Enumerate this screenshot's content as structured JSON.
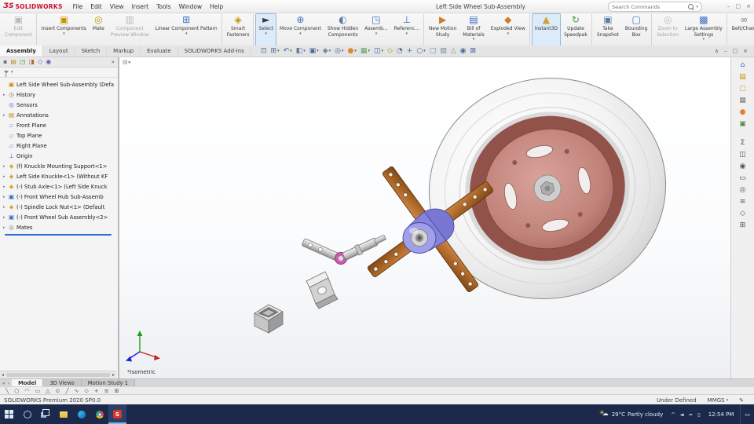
{
  "window": {
    "logo_mark": "ƷS",
    "logo_text": "SOLIDWORKS",
    "menus": [
      {
        "name": "menu-file",
        "label": "File"
      },
      {
        "name": "menu-edit",
        "label": "Edit"
      },
      {
        "name": "menu-view",
        "label": "View"
      },
      {
        "name": "menu-insert",
        "label": "Insert"
      },
      {
        "name": "menu-tools",
        "label": "Tools"
      },
      {
        "name": "menu-window",
        "label": "Window"
      },
      {
        "name": "menu-help",
        "label": "Help"
      }
    ],
    "title": "Left Side Wheel Sub-Assembly",
    "search_placeholder": "Search Commands",
    "search_dd": "▾",
    "controls": [
      {
        "name": "minimize-window-button",
        "ch": "–"
      },
      {
        "name": "maximize-window-button",
        "ch": "▢"
      },
      {
        "name": "close-window-button",
        "ch": "×"
      }
    ]
  },
  "ribbon": {
    "buttons": [
      {
        "name": "edit-component-button",
        "iname": "edit-component-icon",
        "l1": "Edit",
        "l2": "Component",
        "ch": "▣",
        "c": "#9aa6b4",
        "cls": "disabled",
        "sep": "sep",
        "dd": ""
      },
      {
        "name": "insert-components-button",
        "iname": "insert-components-icon",
        "l1": "Insert Components",
        "l2": "",
        "ch": "▣",
        "c": "#c79100",
        "cls": "",
        "sep": "",
        "dd": "▾"
      },
      {
        "name": "mate-button",
        "iname": "mate-icon",
        "l1": "Mate",
        "l2": "",
        "ch": "◎",
        "c": "#c79100",
        "cls": "",
        "sep": "",
        "dd": ""
      },
      {
        "name": "component-preview-window-button",
        "iname": "component-preview-window-icon",
        "l1": "Component",
        "l2": "Preview Window",
        "ch": "▥",
        "c": "#9aa6b4",
        "cls": "disabled",
        "sep": "",
        "dd": ""
      },
      {
        "name": "linear-component-pattern-button",
        "iname": "linear-component-pattern-icon",
        "l1": "Linear Component Pattern",
        "l2": "",
        "ch": "⊞",
        "c": "#3b6fc4",
        "cls": "",
        "sep": "sep",
        "dd": "▾"
      },
      {
        "name": "smart-fasteners-button",
        "iname": "smart-fasteners-icon",
        "l1": "Smart",
        "l2": "Fasteners",
        "ch": "◈",
        "c": "#c79100",
        "cls": "",
        "sep": "sep",
        "dd": ""
      },
      {
        "name": "select-button",
        "iname": "select-cursor-icon",
        "l1": "Select",
        "l2": "",
        "ch": "►",
        "c": "#3a3a3a",
        "cls": "active",
        "sep": "",
        "dd": "▾"
      },
      {
        "name": "move-component-button",
        "iname": "move-component-icon",
        "l1": "Move Component",
        "l2": "",
        "ch": "⊕",
        "c": "#3b6fc4",
        "cls": "",
        "sep": "",
        "dd": "▾"
      },
      {
        "name": "show-hidden-components-button",
        "iname": "show-hidden-components-icon",
        "l1": "Show Hidden",
        "l2": "Components",
        "ch": "◐",
        "c": "#5c7ca3",
        "cls": "",
        "sep": "",
        "dd": ""
      },
      {
        "name": "assembly-features-button",
        "iname": "assembly-features-icon",
        "l1": "Assemb...",
        "l2": "",
        "ch": "◳",
        "c": "#3b6fc4",
        "cls": "",
        "sep": "",
        "dd": "▾"
      },
      {
        "name": "reference-geometry-button",
        "iname": "reference-geometry-icon",
        "l1": "Referenc...",
        "l2": "",
        "ch": "⊥",
        "c": "#3b6fc4",
        "cls": "",
        "sep": "sep",
        "dd": "▾"
      },
      {
        "name": "new-motion-study-button",
        "iname": "new-motion-study-icon",
        "l1": "New Motion",
        "l2": "Study",
        "ch": "▶",
        "c": "#d07a2a",
        "cls": "",
        "sep": "",
        "dd": ""
      },
      {
        "name": "bill-of-materials-button",
        "iname": "bill-of-materials-icon",
        "l1": "Bill of",
        "l2": "Materials",
        "ch": "▤",
        "c": "#3b6fc4",
        "cls": "",
        "sep": "",
        "dd": "▾"
      },
      {
        "name": "exploded-view-button",
        "iname": "exploded-view-icon",
        "l1": "Exploded View",
        "l2": "",
        "ch": "◆",
        "c": "#d07a2a",
        "cls": "",
        "sep": "sep",
        "dd": "▾"
      },
      {
        "name": "instant3d-button",
        "iname": "instant3d-icon",
        "l1": "Instant3D",
        "l2": "",
        "ch": "▲",
        "c": "#d0a12a",
        "cls": "active",
        "sep": "",
        "dd": ""
      },
      {
        "name": "update-speedpak-button",
        "iname": "update-speedpak-icon",
        "l1": "Update",
        "l2": "Speedpak",
        "ch": "↻",
        "c": "#3f9d3f",
        "cls": "",
        "sep": "sep",
        "dd": ""
      },
      {
        "name": "take-snapshot-button",
        "iname": "take-snapshot-icon",
        "l1": "Take",
        "l2": "Snapshot",
        "ch": "▣",
        "c": "#5c7ca3",
        "cls": "",
        "sep": "",
        "dd": ""
      },
      {
        "name": "bounding-box-button",
        "iname": "bounding-box-icon",
        "l1": "Bounding",
        "l2": "Box",
        "ch": "▢",
        "c": "#3b6fc4",
        "cls": "",
        "sep": "sep",
        "dd": ""
      },
      {
        "name": "zoom-to-selection-button",
        "iname": "zoom-to-selection-icon",
        "l1": "Zoom to",
        "l2": "Selection",
        "ch": "◎",
        "c": "#9aa6b4",
        "cls": "disabled",
        "sep": "",
        "dd": ""
      },
      {
        "name": "large-assembly-settings-button",
        "iname": "large-assembly-settings-icon",
        "l1": "Large Assembly",
        "l2": "Settings",
        "ch": "▩",
        "c": "#3b6fc4",
        "cls": "",
        "sep": "sep",
        "dd": "▾"
      },
      {
        "name": "belt-chain-button",
        "iname": "belt-chain-icon",
        "l1": "Belt/Chain",
        "l2": "",
        "ch": "∞",
        "c": "#7a7a7a",
        "cls": "",
        "sep": "",
        "dd": ""
      }
    ]
  },
  "cmtabs": [
    {
      "name": "tab-assembly",
      "label": "Assembly",
      "cls": "active"
    },
    {
      "name": "tab-layout",
      "label": "Layout",
      "cls": ""
    },
    {
      "name": "tab-sketch",
      "label": "Sketch",
      "cls": ""
    },
    {
      "name": "tab-markup",
      "label": "Markup",
      "cls": ""
    },
    {
      "name": "tab-evaluate",
      "label": "Evaluate",
      "cls": ""
    },
    {
      "name": "tab-solidworks-addins",
      "label": "SOLIDWORKS Add-Ins",
      "cls": ""
    }
  ],
  "headsup": [
    {
      "name": "zoom-fit-icon",
      "ch": "⊡",
      "c": "#47689b",
      "dd": ""
    },
    {
      "name": "zoom-area-icon",
      "ch": "⊞",
      "c": "#47689b",
      "dd": "▾"
    },
    {
      "name": "previous-view-icon",
      "ch": "↶",
      "c": "#47689b",
      "dd": "▾"
    },
    {
      "name": "section-view-icon",
      "ch": "◧",
      "c": "#5c7ca3",
      "dd": "▾"
    },
    {
      "name": "view-orientation-icon",
      "ch": "▣",
      "c": "#47689b",
      "dd": "▾"
    },
    {
      "name": "display-style-icon",
      "ch": "◆",
      "c": "#6f8fb5",
      "dd": "▾"
    },
    {
      "name": "hide-show-items-icon",
      "ch": "◎",
      "c": "#47689b",
      "dd": "▾"
    },
    {
      "name": "edit-appearance-icon",
      "ch": "●",
      "c": "#dd8833",
      "dd": "▾"
    },
    {
      "name": "apply-scene-icon",
      "ch": "▦",
      "c": "#6a9a6a",
      "dd": "▾"
    },
    {
      "name": "view-settings-icon",
      "ch": "◫",
      "c": "#47689b",
      "dd": "▾"
    },
    {
      "name": "instant2d-icon",
      "ch": "◇",
      "c": "#b58900",
      "dd": ""
    },
    {
      "name": "rotate-view-icon",
      "ch": "◔",
      "c": "#47689b",
      "dd": ""
    },
    {
      "name": "pan-icon",
      "ch": "+",
      "c": "#47689b",
      "dd": ""
    },
    {
      "name": "zoom-in-out-icon",
      "ch": "○",
      "c": "#47689b",
      "dd": "▾"
    },
    {
      "name": "wireframe-icon",
      "ch": "□",
      "c": "#6f8fb5",
      "dd": ""
    },
    {
      "name": "shadows-icon",
      "ch": "▧",
      "c": "#6f8fb5",
      "dd": ""
    },
    {
      "name": "perspective-icon",
      "ch": "△",
      "c": "#6f8fb5",
      "dd": ""
    },
    {
      "name": "camera-icon",
      "ch": "◉",
      "c": "#47689b",
      "dd": ""
    },
    {
      "name": "fullscreen-icon",
      "ch": "⊠",
      "c": "#47689b",
      "dd": ""
    }
  ],
  "docwin": [
    {
      "name": "collapse-commandmanager-icon",
      "ch": "∧"
    },
    {
      "name": "minimize-document-icon",
      "ch": "–"
    },
    {
      "name": "restore-document-icon",
      "ch": "▢"
    },
    {
      "name": "close-document-icon",
      "ch": "×"
    }
  ],
  "panel": {
    "tabs": [
      {
        "name": "panel-pin-icon",
        "ch": "▪",
        "c": "#6a7a8a"
      },
      {
        "name": "featuremanager-tab",
        "ch": "▤",
        "c": "#b8922a"
      },
      {
        "name": "propertymanager-tab",
        "ch": "◳",
        "c": "#5a8c3c"
      },
      {
        "name": "configurationmanager-tab",
        "ch": "◨",
        "c": "#b56a2a"
      },
      {
        "name": "dimxpertmanager-tab",
        "ch": "◇",
        "c": "#3b6fc4"
      },
      {
        "name": "displaymanager-tab",
        "ch": "◉",
        "c": "#7a4fa0"
      }
    ],
    "overflow": "»",
    "filter_dd": "▾",
    "scroll_left": "◂",
    "scroll_right": "▸",
    "tree": [
      {
        "name": "assembly-root-item",
        "iname": "assembly-icon",
        "arrow": "",
        "ch": "▣",
        "c": "#c79100",
        "label": "Left Side Wheel Sub-Assembly (Defa",
        "cls": "root"
      },
      {
        "name": "history-folder-item",
        "iname": "history-folder-icon",
        "arrow": "▸",
        "ch": "◷",
        "c": "#8a6d3b",
        "label": "History",
        "cls": ""
      },
      {
        "name": "sensors-item",
        "iname": "sensors-icon",
        "arrow": "",
        "ch": "◎",
        "c": "#3b6fc4",
        "label": "Sensors",
        "cls": ""
      },
      {
        "name": "annotations-item",
        "iname": "annotations-folder-icon",
        "arrow": "▸",
        "ch": "▤",
        "c": "#b58900",
        "label": "Annotations",
        "cls": ""
      },
      {
        "name": "front-plane-item",
        "iname": "plane-icon",
        "arrow": "",
        "ch": "▱",
        "c": "#6f8fc0",
        "label": "Front Plane",
        "cls": ""
      },
      {
        "name": "top-plane-item",
        "iname": "plane-icon",
        "arrow": "",
        "ch": "▱",
        "c": "#6f8fc0",
        "label": "Top Plane",
        "cls": ""
      },
      {
        "name": "right-plane-item",
        "iname": "plane-icon",
        "arrow": "",
        "ch": "▱",
        "c": "#6f8fc0",
        "label": "Right Plane",
        "cls": ""
      },
      {
        "name": "origin-item",
        "iname": "origin-icon",
        "arrow": "",
        "ch": "⊥",
        "c": "#3b6fc4",
        "label": "Origin",
        "cls": ""
      },
      {
        "name": "knuckle-mounting-support-item",
        "iname": "part-icon",
        "arrow": "▸",
        "ch": "◈",
        "c": "#c79100",
        "label": "(f) Knuckle Mounting Support<1>",
        "cls": ""
      },
      {
        "name": "left-side-knuckle-item",
        "iname": "part-icon",
        "arrow": "▸",
        "ch": "◈",
        "c": "#c79100",
        "label": "Left Side Knuckle<1> (Without KF",
        "cls": ""
      },
      {
        "name": "stub-axle-item",
        "iname": "part-icon",
        "arrow": "▸",
        "ch": "◈",
        "c": "#c79100",
        "label": "(-) Stub Axle<1> (Left Side Knuck",
        "cls": ""
      },
      {
        "name": "front-wheel-hub-subassembly-item",
        "iname": "subassembly-icon",
        "arrow": "▸",
        "ch": "▣",
        "c": "#2e66c9",
        "label": "(-) Front Wheel Hub Sub-Assemb",
        "cls": ""
      },
      {
        "name": "spindle-lock-nut-item",
        "iname": "part-icon",
        "arrow": "▸",
        "ch": "◈",
        "c": "#c79100",
        "label": "(-) Spindle Lock Nut<1> (Default",
        "cls": ""
      },
      {
        "name": "front-wheel-sub-assembly-item",
        "iname": "subassembly-icon",
        "arrow": "▸",
        "ch": "▣",
        "c": "#2e66c9",
        "label": "(-) Front Wheel Sub Assembly<2>",
        "cls": ""
      },
      {
        "name": "mates-folder-item",
        "iname": "mates-folder-icon",
        "arrow": "▸",
        "ch": "◎",
        "c": "#777777",
        "label": "Mates",
        "cls": ""
      }
    ]
  },
  "graphics": {
    "view_label": "*Isometric",
    "flyout_icon": "▤",
    "flyout_arrow": "▸"
  },
  "taskpane": [
    {
      "name": "solidworks-resources-tab",
      "ch": "⌂",
      "c": "#2e66c9",
      "cls": ""
    },
    {
      "name": "design-library-tab",
      "ch": "▤",
      "c": "#c79100",
      "cls": ""
    },
    {
      "name": "file-explorer-tab",
      "ch": "▢",
      "c": "#c9a227",
      "cls": ""
    },
    {
      "name": "view-palette-tab",
      "ch": "▦",
      "c": "#7a7a7a",
      "cls": ""
    },
    {
      "name": "appearances-scenes-tab",
      "ch": "●",
      "c": "#e08030",
      "cls": ""
    },
    {
      "name": "custom-properties-tab",
      "ch": "▣",
      "c": "#5a8c3c",
      "cls": ""
    },
    {
      "name": "equations-icon",
      "ch": "Σ",
      "c": "#445566",
      "cls": "gap"
    },
    {
      "name": "measure-icon",
      "ch": "◫",
      "c": "#445566",
      "cls": ""
    },
    {
      "name": "mass-properties-icon",
      "ch": "◉",
      "c": "#445566",
      "cls": ""
    },
    {
      "name": "section-properties-icon",
      "ch": "▭",
      "c": "#445566",
      "cls": ""
    },
    {
      "name": "sensors-panel-icon",
      "ch": "◎",
      "c": "#445566",
      "cls": ""
    },
    {
      "name": "stats-icon",
      "ch": "≡",
      "c": "#445566",
      "cls": ""
    },
    {
      "name": "check-icon",
      "ch": "◇",
      "c": "#445566",
      "cls": ""
    },
    {
      "name": "compare-icon",
      "ch": "⊞",
      "c": "#445566",
      "cls": ""
    }
  ],
  "bottom": {
    "nav": [
      {
        "name": "tab-scroll-first-icon",
        "ch": "«"
      },
      {
        "name": "tab-scroll-left-icon",
        "ch": "‹"
      }
    ],
    "tabs": [
      {
        "name": "model-tab",
        "label": "Model",
        "cls": "active"
      },
      {
        "name": "threed-views-tab",
        "label": "3D Views",
        "cls": ""
      },
      {
        "name": "motion-study-tab",
        "label": "Motion Study 1",
        "cls": ""
      }
    ]
  },
  "sketchbar": [
    {
      "name": "line-tool-icon",
      "ch": "╲"
    },
    {
      "name": "circle-tool-icon",
      "ch": "○"
    },
    {
      "name": "arc-tool-icon",
      "ch": "◠"
    },
    {
      "name": "rectangle-tool-icon",
      "ch": "▭"
    },
    {
      "name": "polygon-tool-icon",
      "ch": "△"
    },
    {
      "name": "point-tool-icon",
      "ch": "⊙"
    },
    {
      "name": "centerline-tool-icon",
      "ch": "╱"
    },
    {
      "name": "spline-tool-icon",
      "ch": "∿"
    },
    {
      "name": "dimension-tool-icon",
      "ch": "◇"
    },
    {
      "name": "trim-tool-icon",
      "ch": "+"
    },
    {
      "name": "mirror-tool-icon",
      "ch": "≡"
    },
    {
      "name": "pattern-tool-icon",
      "ch": "⊞"
    }
  ],
  "status": {
    "left": "SOLIDWORKS Premium 2020 SP0.0",
    "state": "Under Defined",
    "units": "MMGS",
    "units_dd": "▾",
    "edit_icon": "✎"
  },
  "taskbar": {
    "apps": [
      {
        "name": "start-button",
        "cls": "tb-start",
        "ch": ""
      },
      {
        "name": "search-button",
        "cls": "tb-search",
        "ch": ""
      },
      {
        "name": "task-view-button",
        "cls": "tb-task",
        "ch": ""
      },
      {
        "name": "file-explorer-button",
        "cls": "tb-folder",
        "ch": ""
      },
      {
        "name": "edge-button",
        "cls": "tb-edge",
        "ch": ""
      },
      {
        "name": "chrome-button",
        "cls": "tb-chrome",
        "ch": ""
      },
      {
        "name": "solidworks-taskbar-button",
        "cls": "tb-sw active",
        "ch": "S"
      }
    ],
    "weather": {
      "sun": "☀",
      "cloud": "☁",
      "temp": "29°C",
      "cond": "Partly cloudy"
    },
    "tray": [
      {
        "name": "tray-expand-icon",
        "ch": "^"
      },
      {
        "name": "volume-icon",
        "ch": "◄"
      },
      {
        "name": "network-icon",
        "ch": "≈"
      },
      {
        "name": "battery-icon",
        "ch": "▯"
      }
    ],
    "time": "12:54 PM",
    "action_center": "▭"
  }
}
